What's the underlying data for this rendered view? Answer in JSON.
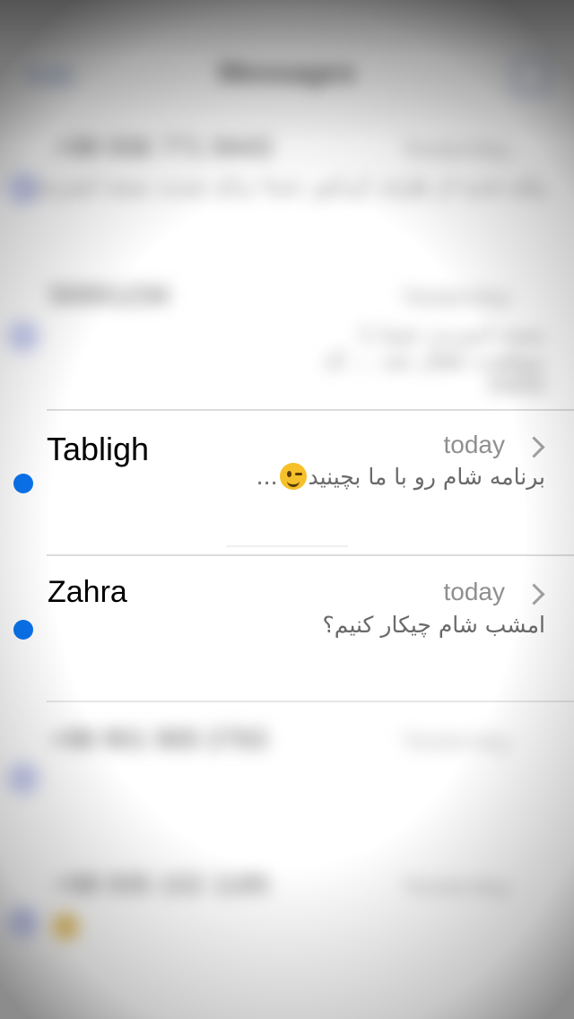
{
  "nav": {
    "title": "Messages",
    "edit_label": "Edit"
  },
  "conversations": [
    {
      "name": "+98 936 771 9443",
      "time": "Yesterday",
      "preview": "پیام جدید از طرف اپراتور شما برای تمدید بسته اینترنت",
      "unread": true,
      "blurred": true
    },
    {
      "name": "50001234",
      "time": "Yesterday",
      "preview": "بسته اینترنت شما با موفقیت فعال شد ... کد 0000",
      "unread": true,
      "blurred": true
    },
    {
      "name": "Tabligh",
      "time": "today",
      "preview": "برنامه شام رو با ما بچینید",
      "preview_suffix": "...",
      "emoji": "winking-face",
      "unread": true,
      "blurred": false
    },
    {
      "name": "Zahra",
      "time": "today",
      "preview": "امشب شام چیکار کنیم؟",
      "unread": true,
      "blurred": false
    },
    {
      "name": "+98 901 900 2763",
      "time": "Yesterday",
      "preview": "",
      "unread": true,
      "blurred": true
    },
    {
      "name": "+98 935 102 1185",
      "time": "Yesterday",
      "preview": "",
      "unread": true,
      "blurred": true
    }
  ],
  "colors": {
    "unread_dot": "#0a74f0",
    "time_text": "#8f8f8f",
    "preview_text": "#6a6a6a"
  }
}
